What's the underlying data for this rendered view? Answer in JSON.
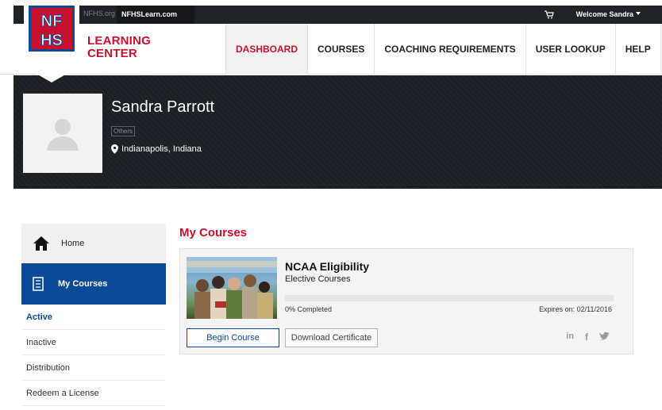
{
  "topbar": {
    "site1": "NFHS.org",
    "site2": "NFHSLearn.com",
    "welcome": "Welcome Sandra"
  },
  "brand": {
    "line1": "LEARNING",
    "line2": "CENTER",
    "logo_text": "NFHS"
  },
  "nav": [
    {
      "label": "DASHBOARD",
      "active": true
    },
    {
      "label": "COURSES",
      "active": false
    },
    {
      "label": "COACHING REQUIREMENTS",
      "active": false
    },
    {
      "label": "USER LOOKUP",
      "active": false
    },
    {
      "label": "HELP",
      "active": false
    }
  ],
  "profile": {
    "name": "Sandra Parrott",
    "role": "Others",
    "location": "Indianapolis, Indiana"
  },
  "sidebar": {
    "home": "Home",
    "my_courses": "My Courses",
    "links": [
      "Active",
      "Inactive",
      "Distribution",
      "Redeem a License"
    ]
  },
  "main": {
    "heading": "My Courses"
  },
  "course": {
    "title": "NCAA Eligibility",
    "category": "Elective Courses",
    "completed_label": "0% Completed",
    "progress": 0,
    "expires": "Expires on: 02/11/2016",
    "begin_label": "Begin Course",
    "cert_label": "Download Certificate"
  },
  "colors": {
    "brand_red": "#c8102e",
    "brand_blue": "#0a4a96",
    "dark": "#1c1f24"
  },
  "icons": [
    "cart-icon",
    "caret-down-icon",
    "home-icon",
    "book-icon",
    "map-pin-icon",
    "linkedin-icon",
    "facebook-icon",
    "twitter-icon",
    "user-placeholder-icon"
  ]
}
